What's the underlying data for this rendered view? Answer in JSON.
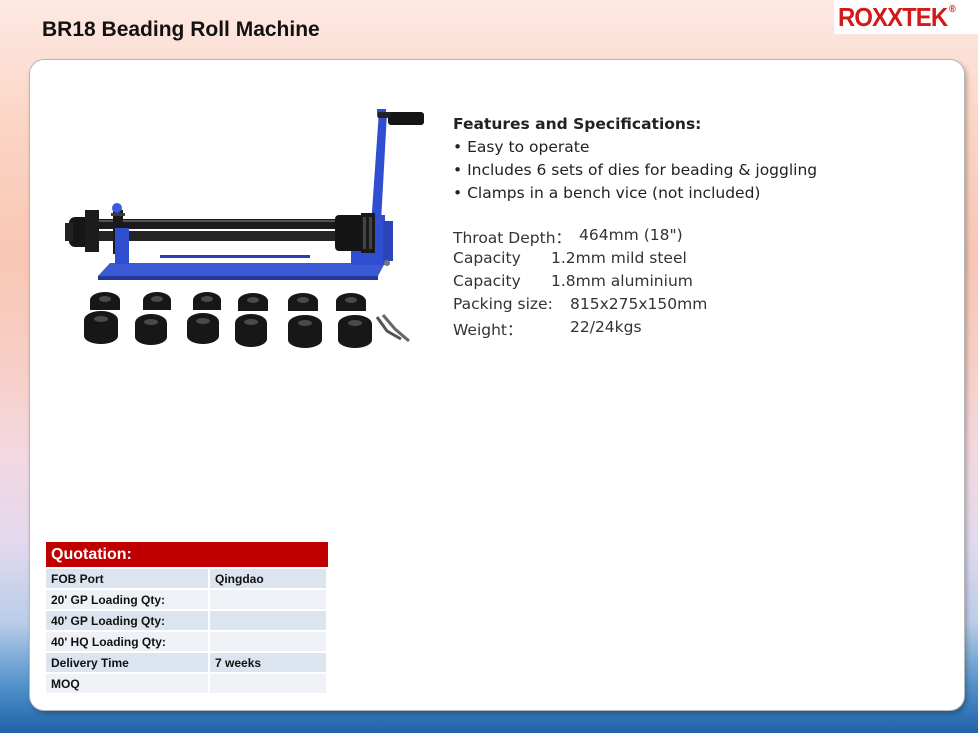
{
  "header": {
    "title": "BR18 Beading Roll Machine",
    "logo_text": "ROXXTEK",
    "logo_mark": "®"
  },
  "colors": {
    "accent_red": "#c00000",
    "machine_blue": "#2f4fd0",
    "logo_red": "#d11a1a"
  },
  "features": {
    "heading": "Features and Specifications:",
    "items": [
      "• Easy to operate",
      "• Includes 6 sets of dies for beading & joggling",
      "• Clamps in a bench vice (not included)"
    ]
  },
  "specs": [
    {
      "label": "Throat Depth：",
      "value": "464mm (18\")"
    },
    {
      "label": "Capacity",
      "value": "1.2mm mild steel"
    },
    {
      "label": "Capacity",
      "value": "1.8mm aluminium"
    },
    {
      "label": "Packing size:",
      "value": "815x275x150mm"
    },
    {
      "label": "Weight：",
      "value": "22/24kgs"
    }
  ],
  "quotation": {
    "heading": "Quotation:",
    "rows": [
      {
        "label": "FOB Port",
        "value": "Qingdao"
      },
      {
        "label": "20' GP Loading Qty:",
        "value": ""
      },
      {
        "label": "40' GP Loading Qty:",
        "value": ""
      },
      {
        "label": "40' HQ Loading Qty:",
        "value": ""
      },
      {
        "label": "Delivery Time",
        "value": "7 weeks"
      },
      {
        "label": "MOQ",
        "value": ""
      }
    ]
  }
}
